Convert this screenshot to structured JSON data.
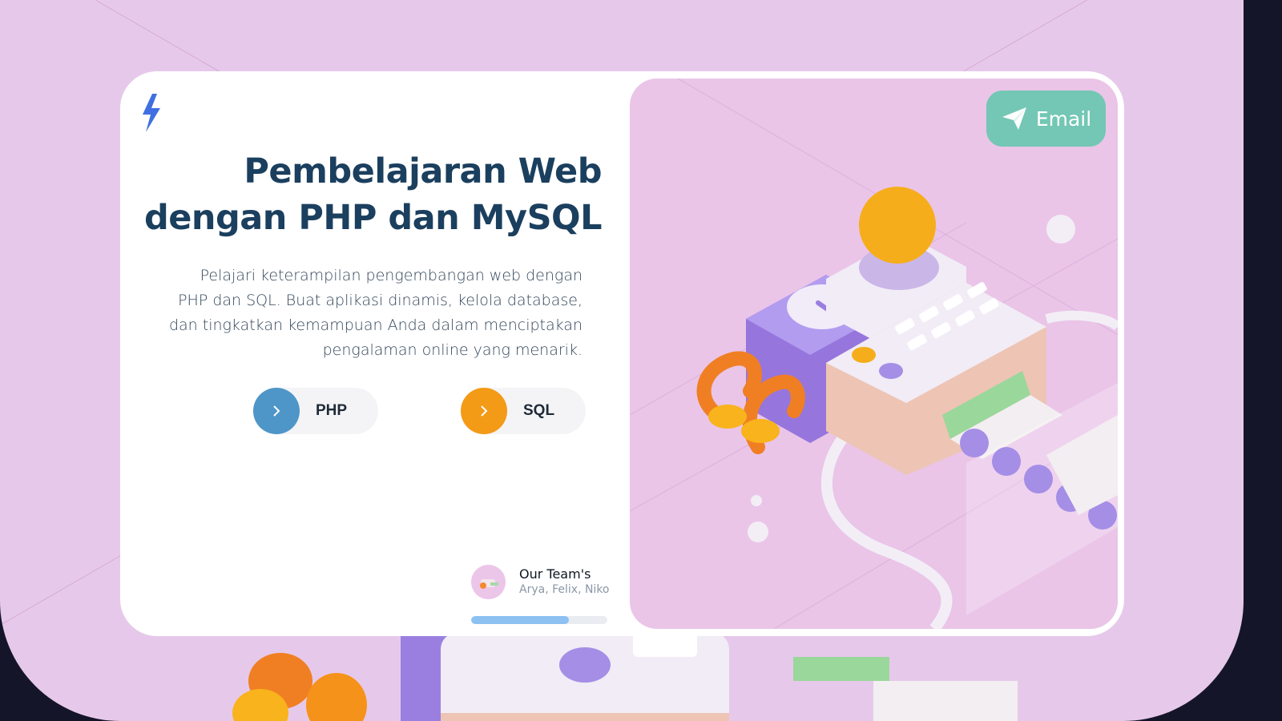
{
  "logo": {
    "icon": "lightning-bolt-icon",
    "color": "#3f6fe0"
  },
  "headline": {
    "line1": "Pembelajaran Web",
    "line2": "dengan PHP dan MySQL"
  },
  "description": "Pelajari keterampilan pengembangan web dengan PHP dan SQL. Buat aplikasi dinamis, kelola database, dan tingkatkan kemampuan Anda dalam menciptakan pengalaman online yang menarik.",
  "buttons": [
    {
      "label": "PHP",
      "icon": "chevron-right-icon",
      "color": "#4f96c8"
    },
    {
      "label": "SQL",
      "icon": "chevron-right-icon",
      "color": "#f39a17"
    }
  ],
  "team": {
    "title": "Our Team's",
    "members": "Arya, Felix, Niko"
  },
  "progress": {
    "value": 0.72
  },
  "email_button": {
    "label": "Email",
    "icon": "send-icon",
    "color": "#73c7b4"
  },
  "colors": {
    "headline": "#1b3f5e",
    "background": "#e6c9ea"
  }
}
